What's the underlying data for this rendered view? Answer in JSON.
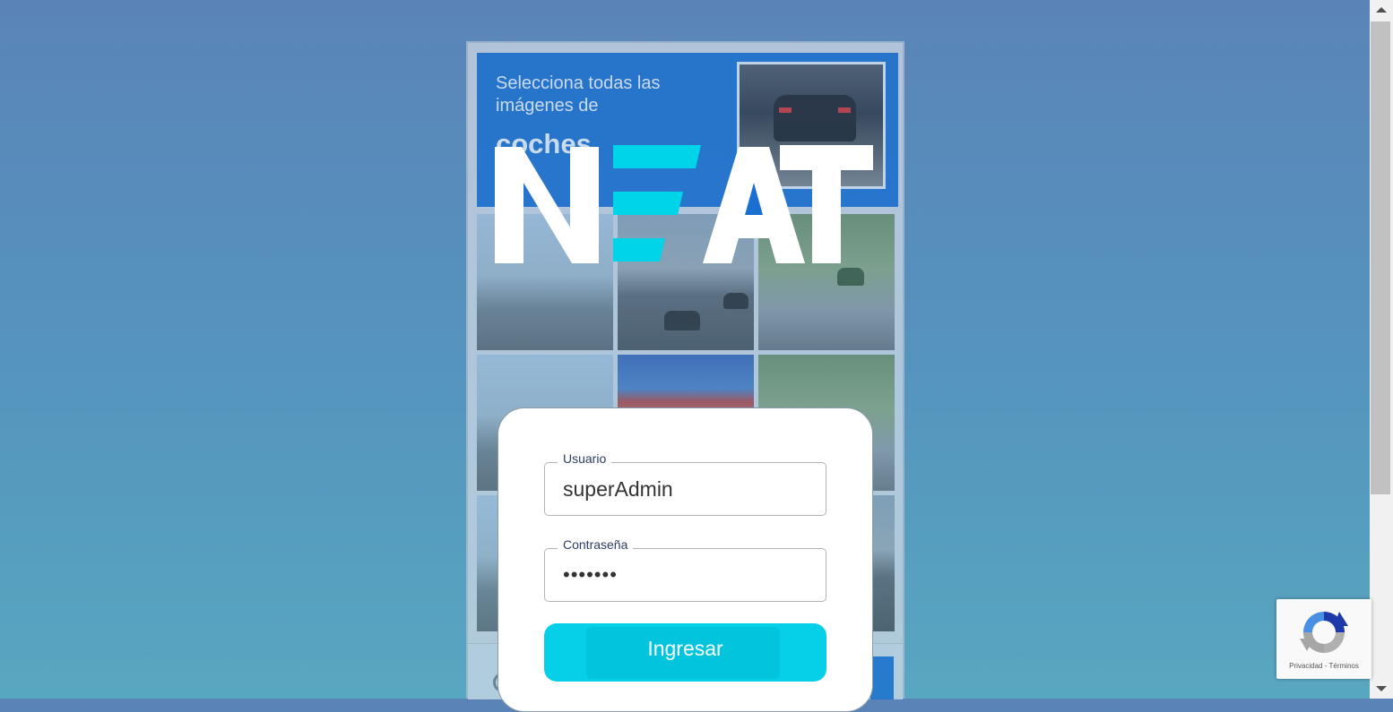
{
  "captcha": {
    "instruction_line": "Selecciona todas las imágenes de",
    "object_word": "coches"
  },
  "logo": {
    "text": "NEAT",
    "colors": {
      "letters": "#ffffff",
      "accent": "#00d4e8"
    }
  },
  "login": {
    "username_label": "Usuario",
    "username_value": "superAdmin",
    "password_label": "Contraseña",
    "password_value": "•••••••",
    "submit_label": "Ingresar"
  },
  "recaptcha_badge": {
    "privacy": "Privacidad",
    "separator": "-",
    "terms": "Términos"
  },
  "colors": {
    "button": "#05d0e8",
    "captcha_blue": "#1a6fd1"
  }
}
